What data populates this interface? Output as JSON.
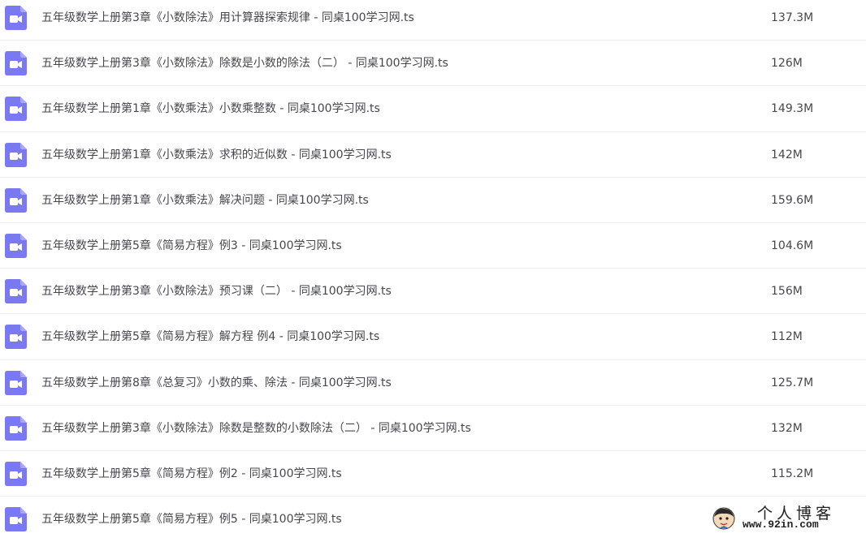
{
  "colors": {
    "icon_bg": "#7b79f1",
    "text": "#45474d",
    "divider": "#eef0f4"
  },
  "file_icon": "video-file-icon",
  "files": [
    {
      "name": "五年级数学上册第3章《小数除法》用计算器探索规律 - 同桌100学习网.ts",
      "size": "137.3M"
    },
    {
      "name": "五年级数学上册第3章《小数除法》除数是小数的除法（二） - 同桌100学习网.ts",
      "size": "126M"
    },
    {
      "name": "五年级数学上册第1章《小数乘法》小数乘整数 - 同桌100学习网.ts",
      "size": "149.3M"
    },
    {
      "name": "五年级数学上册第1章《小数乘法》求积的近似数 - 同桌100学习网.ts",
      "size": "142M"
    },
    {
      "name": "五年级数学上册第1章《小数乘法》解决问题 - 同桌100学习网.ts",
      "size": "159.6M"
    },
    {
      "name": "五年级数学上册第5章《简易方程》例3 - 同桌100学习网.ts",
      "size": "104.6M"
    },
    {
      "name": "五年级数学上册第3章《小数除法》预习课（二） - 同桌100学习网.ts",
      "size": "156M"
    },
    {
      "name": "五年级数学上册第5章《简易方程》解方程 例4 - 同桌100学习网.ts",
      "size": "112M"
    },
    {
      "name": "五年级数学上册第8章《总复习》小数的乘、除法 - 同桌100学习网.ts",
      "size": "125.7M"
    },
    {
      "name": "五年级数学上册第3章《小数除法》除数是整数的小数除法（二） - 同桌100学习网.ts",
      "size": "132M"
    },
    {
      "name": "五年级数学上册第5章《简易方程》例2 - 同桌100学习网.ts",
      "size": "115.2M"
    },
    {
      "name": "五年级数学上册第5章《简易方程》例5 - 同桌100学习网.ts",
      "size": "-"
    }
  ],
  "watermark": {
    "title": "个人博客",
    "url": "www.92in.com"
  }
}
